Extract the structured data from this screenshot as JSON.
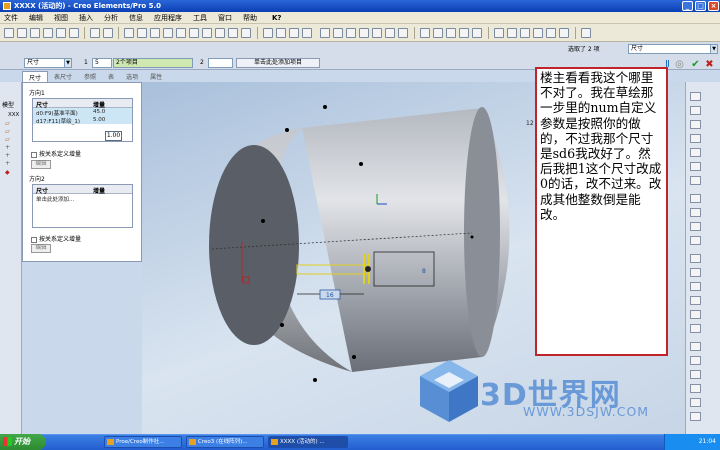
{
  "window": {
    "title": "XXXX (活动的) - Creo Elements/Pro 5.0"
  },
  "menu": [
    "文件",
    "编辑",
    "视图",
    "插入",
    "分析",
    "信息",
    "应用程序",
    "工具",
    "窗口",
    "帮助",
    "K?"
  ],
  "toolbar_filter": {
    "label": "选取了 2 项",
    "value": "尺寸"
  },
  "dashboard": {
    "type_combo": "尺寸",
    "dir1_num": "1",
    "dir1_value": "5",
    "dir1_items": "2个项目",
    "dir2_num": "2",
    "dir2_value": "",
    "dir2_items": "单击此处添加项目",
    "tabs": [
      "尺寸",
      "表尺寸",
      "参照",
      "表",
      "选项",
      "属性"
    ]
  },
  "dim_panel": {
    "dir1_title": "方向1",
    "headers": [
      "尺寸",
      "增量"
    ],
    "dir1_rows": [
      {
        "dim": "d0:F9(基准平面)",
        "inc": "45.0"
      },
      {
        "dim": "d17:F11(草绘_1)",
        "inc": "5.00"
      }
    ],
    "dir1_checkbox": "按关系定义增量",
    "dir1_edit": "编辑",
    "dir2_title": "方向2",
    "dir2_placeholder": "单击此处添加...",
    "dir2_checkbox": "按关系定义增量",
    "dir2_edit": "编辑",
    "value_box": "1.00"
  },
  "model_tree": {
    "header": "模型",
    "first_item": "XXX"
  },
  "viewport": {
    "dims": {
      "dim_16": "16",
      "dim_8": "8",
      "dim_12": "12"
    }
  },
  "annotation": "楼主看看我这个哪里不对了。我在草绘那一步里的num自定义参数是按照你的做的，不过我那个尺寸是sd6我改好了。然后我把1这个尺寸改成0的话，改不过来。改成其他整数倒是能改。",
  "watermark": {
    "text": "3D世界网",
    "url": "WWW.3DSJW.COM"
  },
  "taskbar": {
    "start": "开始",
    "tasks": [
      "Proe/Creo制作社...",
      "Creo3 (在线阵列)...",
      "XXXX (活动的) ..."
    ],
    "clock": "21:04"
  },
  "colors": {
    "annotation_border": "#c0242b",
    "dim_row_highlight": "#cde6f5",
    "title_bar": "#0b3fb4",
    "watermark": "#5f93d6"
  }
}
